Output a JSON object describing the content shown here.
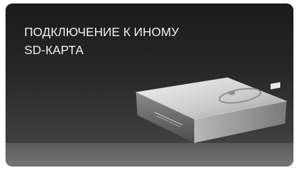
{
  "message": {
    "line1": "ПОДКЛЮЧЕНИЕ К ИНОМУ",
    "line2": "SD-КАРТА"
  },
  "icons": {
    "device": "external-drive-icon"
  }
}
